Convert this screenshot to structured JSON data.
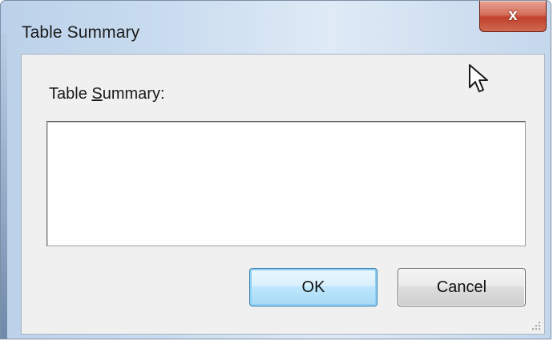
{
  "window": {
    "title": "Table Summary",
    "close_glyph": "x"
  },
  "form": {
    "summary_label_prefix": "Table ",
    "summary_label_accel": "S",
    "summary_label_suffix": "ummary:",
    "summary_value": ""
  },
  "buttons": {
    "ok_label": "OK",
    "cancel_label": "Cancel"
  },
  "icons": {
    "close": "close-icon",
    "cursor": "mouse-pointer-icon",
    "grip": "resize-grip-icon"
  },
  "colors": {
    "ok_border": "#3c7fb1",
    "close_red": "#c0402a",
    "dialog_bg": "#f0f0f0"
  }
}
